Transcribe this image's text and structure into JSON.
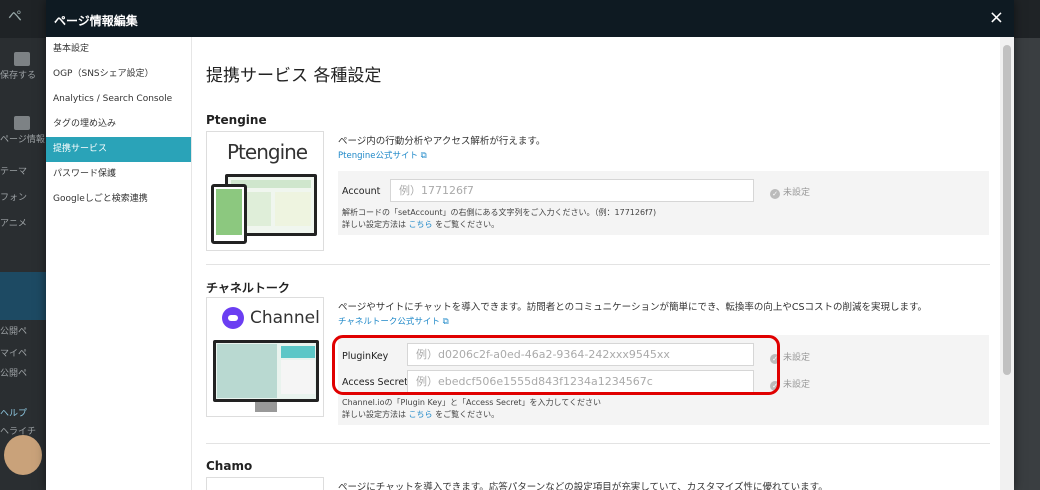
{
  "background": {
    "logo": "ペ",
    "sidebar_items": [
      "保存する",
      "ページ情報",
      "テーマ",
      "フォン",
      "アニメ",
      "公開ペ",
      "マイペ",
      "公開ペ",
      "ヘルプ",
      "ヘライチ"
    ]
  },
  "modal": {
    "title": "ページ情報編集",
    "close_icon": "×"
  },
  "nav": {
    "items": [
      {
        "label": "基本設定"
      },
      {
        "label": "OGP（SNSシェア設定）"
      },
      {
        "label": "Analytics / Search Console"
      },
      {
        "label": "タグの埋め込み"
      },
      {
        "label": "提携サービス"
      },
      {
        "label": "パスワード保護"
      },
      {
        "label": "Googleしごと検索連携"
      }
    ],
    "active_index": 4
  },
  "content": {
    "title": "提携サービス 各種設定",
    "ptengine": {
      "name": "Ptengine",
      "logo_text": "Ptengine",
      "description": "ページ内の行動分析やアクセス解析が行えます。",
      "link": "Ptengine公式サイト",
      "account_label": "Account",
      "account_placeholder": "例）177126f7",
      "account_status": "未設定",
      "note1": "解析コードの「setAccount」の右側にある文字列をご入力ください。（例：177126f7)",
      "note2_pre": "詳しい設定方法は",
      "note2_link": "こちら",
      "note2_post": "をご覧ください。"
    },
    "channel": {
      "name": "チャネルトーク",
      "logo_text": "Channel",
      "description": "ページやサイトにチャットを導入できます。訪問者とのコミュニケーションが簡単にでき、転換率の向上やCSコストの削減を実現します。",
      "link": "チャネルトーク公式サイト",
      "pluginkey_label": "PluginKey",
      "pluginkey_placeholder": "例）d0206c2f-a0ed-46a2-9364-242xxx9545xx",
      "pluginkey_status": "未設定",
      "secret_label": "Access Secret",
      "secret_placeholder": "例）ebedcf506e1555d843f1234a1234567c",
      "secret_status": "未設定",
      "note1": "Channel.ioの「Plugin Key」と「Access Secret」を入力してください",
      "note2_pre": "詳しい設定方法は",
      "note2_link": "こちら",
      "note2_post": "をご覧ください。"
    },
    "chamo": {
      "name": "Chamo",
      "description": "ページにチャットを導入できます。応答パターンなどの設定項目が充実していて、カスタマイズ性に優れています。"
    }
  },
  "colors": {
    "header_bg": "#0e1a22",
    "nav_active": "#2aa3b8",
    "link": "#1e88c8",
    "highlight": "#e00000"
  }
}
